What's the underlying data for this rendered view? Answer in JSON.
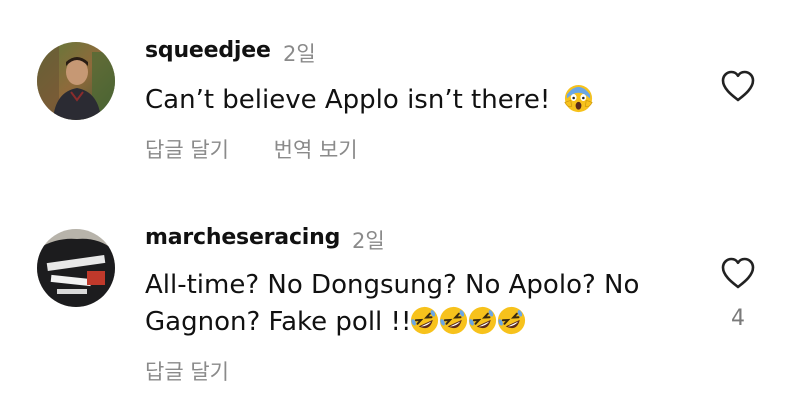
{
  "comments": [
    {
      "username": "squeedjee",
      "time": "2일",
      "text": "Can’t believe Applo isn’t there!",
      "emoji": [
        "face-screaming-in-fear"
      ],
      "reply_label": "답글 달기",
      "translate_label": "번역 보기",
      "like_count": ""
    },
    {
      "username": "marcheseracing",
      "time": "2일",
      "text_line1": "All-time? No Dongsung? No Apolo? No",
      "text_line2": "Gagnon?  Fake poll !!",
      "emoji": [
        "rolling-on-floor-laughing",
        "rolling-on-floor-laughing",
        "rolling-on-floor-laughing",
        "rolling-on-floor-laughing"
      ],
      "reply_label": "답글 달기",
      "like_count": "4"
    }
  ],
  "colors": {
    "text": "#111111",
    "muted": "#8a8a8a",
    "emoji_yellow": "#f7c21c"
  }
}
